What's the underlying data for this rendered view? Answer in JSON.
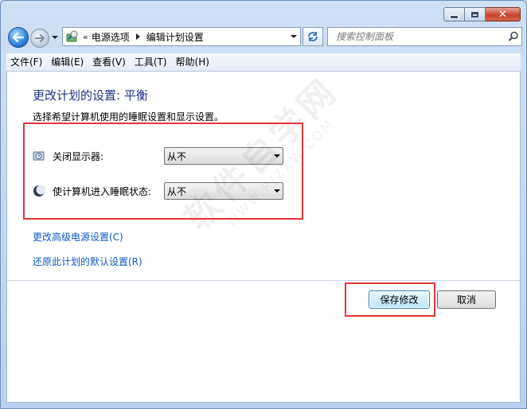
{
  "window": {
    "caption": {
      "minimize": "minimize",
      "maximize": "maximize",
      "close": "close"
    }
  },
  "address": {
    "overflow": "«",
    "crumbs": [
      "电源选项",
      "编辑计划设置"
    ]
  },
  "search": {
    "placeholder": "搜索控制面板"
  },
  "menu": [
    "文件(F)",
    "编辑(E)",
    "查看(V)",
    "工具(T)",
    "帮助(H)"
  ],
  "main": {
    "heading": "更改计划的设置: 平衡",
    "description": "选择希望计算机使用的睡眠设置和显示设置。",
    "settings": [
      {
        "label": "关闭显示器:",
        "value": "从不",
        "icon": "monitor-clock-icon"
      },
      {
        "label": "使计算机进入睡眠状态:",
        "value": "从不",
        "icon": "moon-icon"
      }
    ],
    "links": [
      "更改高级电源设置(C)",
      "还原此计划的默认设置(R)"
    ],
    "buttons": {
      "save": "保存修改",
      "cancel": "取消"
    }
  },
  "watermark": {
    "line1": "软件自学网",
    "line2": "WWW.RJZXW.COM"
  },
  "colors": {
    "heading": "#1e3287",
    "link": "#0c5bc8",
    "highlight": "#e53535"
  }
}
